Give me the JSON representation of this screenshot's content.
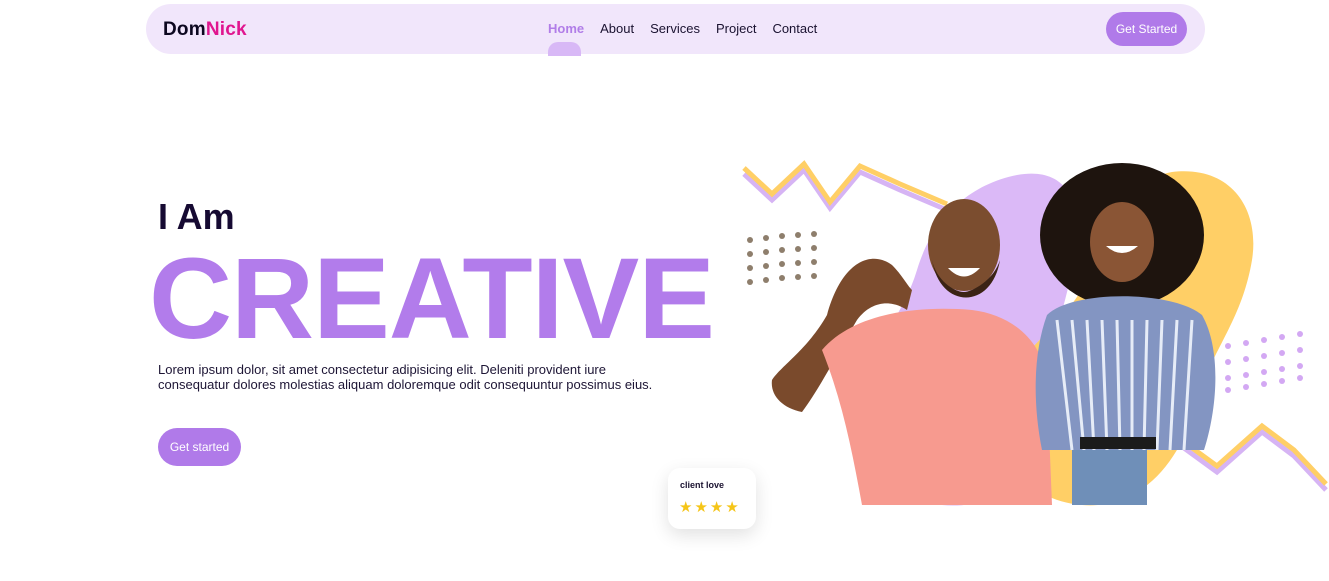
{
  "brand": {
    "part1": "Dom",
    "part2": "Nick"
  },
  "nav": {
    "links": [
      "Home",
      "About",
      "Services",
      "Project",
      "Contact"
    ],
    "active": "Home",
    "cta_label": "Get Started"
  },
  "hero": {
    "intro": "I Am",
    "headline": "CREATIVE",
    "description": "Lorem ipsum dolor, sit amet consectetur adipisicing elit. Deleniti provident iure consequatur dolores molestias aliquam doloremque odit consequuntur possimus eius.",
    "cta_label": "Get started"
  },
  "client_card": {
    "title": "client love",
    "rating": 4
  },
  "colors": {
    "accent": "#b27ceb",
    "nav_bg": "#f1e6fb",
    "logo_pink": "#e0168f",
    "blob_yellow": "#ffcf66",
    "blob_purple": "#dbb9f7"
  }
}
